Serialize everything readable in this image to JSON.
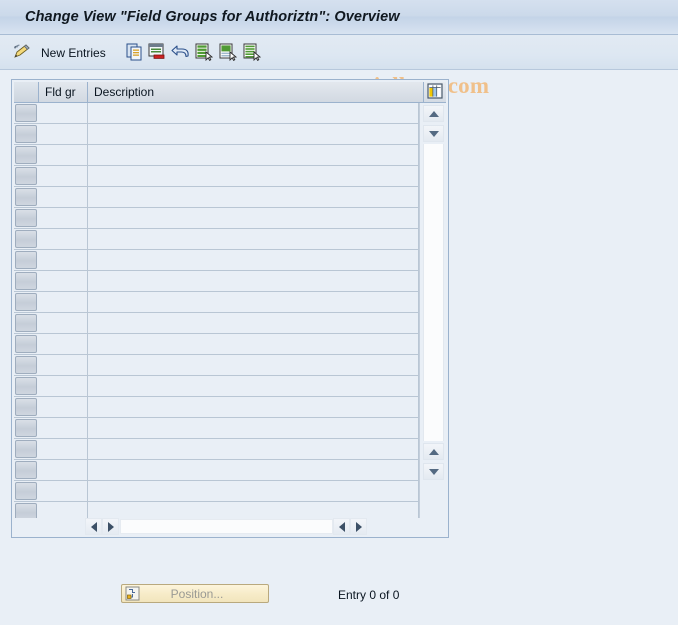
{
  "window": {
    "title": "Change View \"Field Groups for Authoriztn\": Overview"
  },
  "toolbar": {
    "display_change_icon": "pencil-toggle-icon",
    "new_entries_label": "New Entries",
    "buttons": [
      {
        "icon": "copy-icon",
        "name": "copy-as-button"
      },
      {
        "icon": "delete-row-icon",
        "name": "delete-button"
      },
      {
        "icon": "undo-icon",
        "name": "undo-button"
      },
      {
        "icon": "select-all-icon",
        "name": "select-all-button"
      },
      {
        "icon": "deselect-all-icon",
        "name": "deselect-all-button"
      },
      {
        "icon": "details-icon",
        "name": "details-button"
      }
    ],
    "watermark": "www.tutorialkart.com"
  },
  "grid": {
    "config_icon": "column-config-icon",
    "columns": [
      {
        "key": "selector",
        "label": ""
      },
      {
        "key": "fld_gr",
        "label": "Fld gr"
      },
      {
        "key": "description",
        "label": "Description"
      }
    ],
    "row_count": 20,
    "rows": [
      {
        "fld_gr": "",
        "description": ""
      },
      {
        "fld_gr": "",
        "description": ""
      },
      {
        "fld_gr": "",
        "description": ""
      },
      {
        "fld_gr": "",
        "description": ""
      },
      {
        "fld_gr": "",
        "description": ""
      },
      {
        "fld_gr": "",
        "description": ""
      },
      {
        "fld_gr": "",
        "description": ""
      },
      {
        "fld_gr": "",
        "description": ""
      },
      {
        "fld_gr": "",
        "description": ""
      },
      {
        "fld_gr": "",
        "description": ""
      },
      {
        "fld_gr": "",
        "description": ""
      },
      {
        "fld_gr": "",
        "description": ""
      },
      {
        "fld_gr": "",
        "description": ""
      },
      {
        "fld_gr": "",
        "description": ""
      },
      {
        "fld_gr": "",
        "description": ""
      },
      {
        "fld_gr": "",
        "description": ""
      },
      {
        "fld_gr": "",
        "description": ""
      },
      {
        "fld_gr": "",
        "description": ""
      },
      {
        "fld_gr": "",
        "description": ""
      },
      {
        "fld_gr": "",
        "description": ""
      }
    ],
    "scroll": {
      "up_icon": "scroll-up-icon",
      "down_icon": "scroll-down-icon",
      "page_up_icon": "page-up-icon",
      "page_down_icon": "page-down-icon",
      "left_icon": "scroll-left-icon",
      "right_icon": "scroll-right-icon"
    }
  },
  "footer": {
    "position_button_label": "Position...",
    "position_button_icon": "position-icon",
    "entry_status": "Entry 0 of 0"
  },
  "colors": {
    "page_background": "#e9eff6",
    "title_bar": "#cbd9ea",
    "grid_border": "#9bb2cd",
    "watermark": "#f0c08a",
    "button_yellow": "#f7ecc9"
  }
}
